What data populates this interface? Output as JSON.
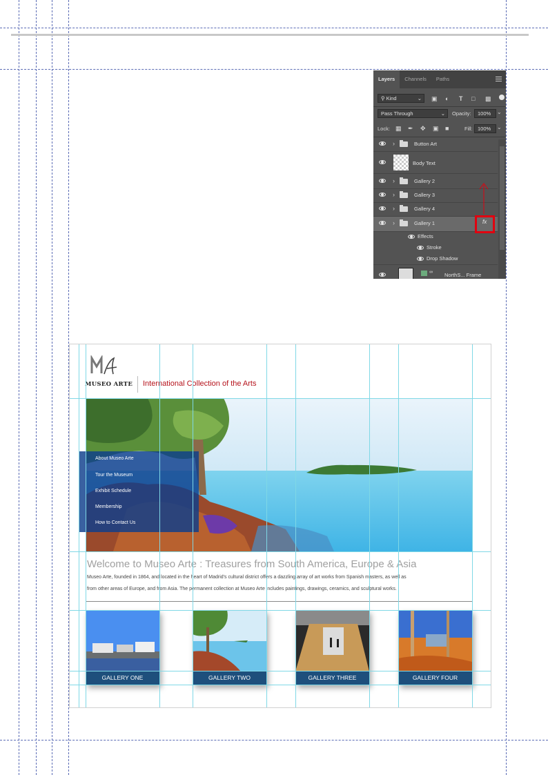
{
  "layers_panel": {
    "tabs": [
      "Layers",
      "Channels",
      "Paths"
    ],
    "filter": "Kind",
    "blend_mode": "Pass Through",
    "opacity_label": "Opacity:",
    "opacity_value": "100%",
    "lock_label": "Lock:",
    "fill_label": "Fill:",
    "fill_value": "100%",
    "layers": {
      "button_art": "Button Art",
      "body_text": "Body Text",
      "gallery_2": "Gallery 2",
      "gallery_3": "Gallery 3",
      "gallery_4": "Gallery 4",
      "gallery_1": "Gallery 1",
      "effects": "Effects",
      "stroke": "Stroke",
      "drop_shadow": "Drop Shadow",
      "northshore_frame": "NorthS... Frame"
    },
    "fx_badge": "fx",
    "highlight_color": "#e1000f"
  },
  "site": {
    "logo_text": "MUSEO ARTE",
    "tagline": "International Collection of the Arts",
    "tagline_color": "#b5121b",
    "nav": [
      "About Museo Arte",
      "Tour the Museum",
      "Exhibit Schedule",
      "Membership",
      "How to Contact Us"
    ],
    "headline": "Welcome to Museo Arte : Treasures from South America, Europe & Asia",
    "body_line1": "Museo Arte, founded in 1864, and located in the heart of Madrid's cultural district offers a dazzling array of art works from Spanish masters, as well as",
    "body_line2": "from other areas of Europe, and from Asia. The permanent collection at Museo Arte includes paintings, drawings, ceramics, and sculptural works.",
    "galleries": [
      "GALLERY ONE",
      "GALLERY TWO",
      "GALLERY THREE",
      "GALLERY FOUR"
    ],
    "gallery_bar_color": "#1e4f7c"
  }
}
